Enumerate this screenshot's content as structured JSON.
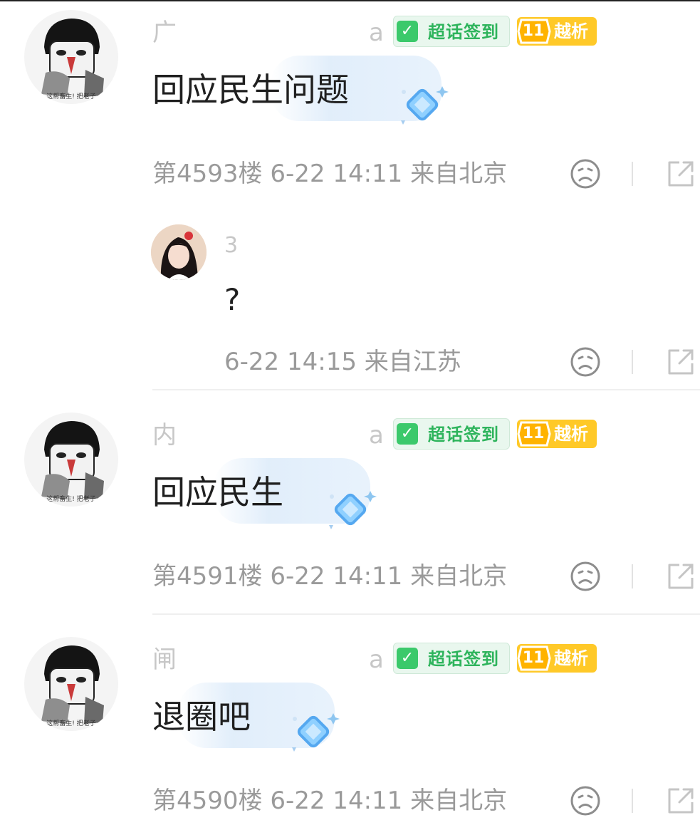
{
  "comments": [
    {
      "username": "广",
      "username_tail": "a",
      "badge_sign": "超话签到",
      "badge_level": "11",
      "badge_level_name": "越析",
      "content": "回应民生问题",
      "meta": "第4593楼 6-22 14:11 来自北京"
    },
    {
      "username": "内",
      "username_tail": "a",
      "badge_sign": "超话签到",
      "badge_level": "11",
      "badge_level_name": "越析",
      "content": "回应民生",
      "meta": "第4591楼 6-22 14:11 来自北京"
    },
    {
      "username": "闸",
      "username_tail": "a",
      "badge_sign": "超话签到",
      "badge_level": "11",
      "badge_level_name": "越析",
      "content": "退圈吧",
      "meta": "第4590楼 6-22 14:11 来自北京"
    }
  ],
  "reply": {
    "username": "3",
    "content": "?",
    "meta": "6-22 14:15 来自江苏"
  },
  "avatar_caption": "这帮畜生! 把老子",
  "colors": {
    "badge_green": "#3bc96b",
    "badge_gold": "#ffc928",
    "meta_gray": "#9a9a9a",
    "bubble_blue": "#dfeefb"
  },
  "icons": [
    "dislike-face-icon",
    "share-icon",
    "diamond-icon",
    "check-icon"
  ]
}
